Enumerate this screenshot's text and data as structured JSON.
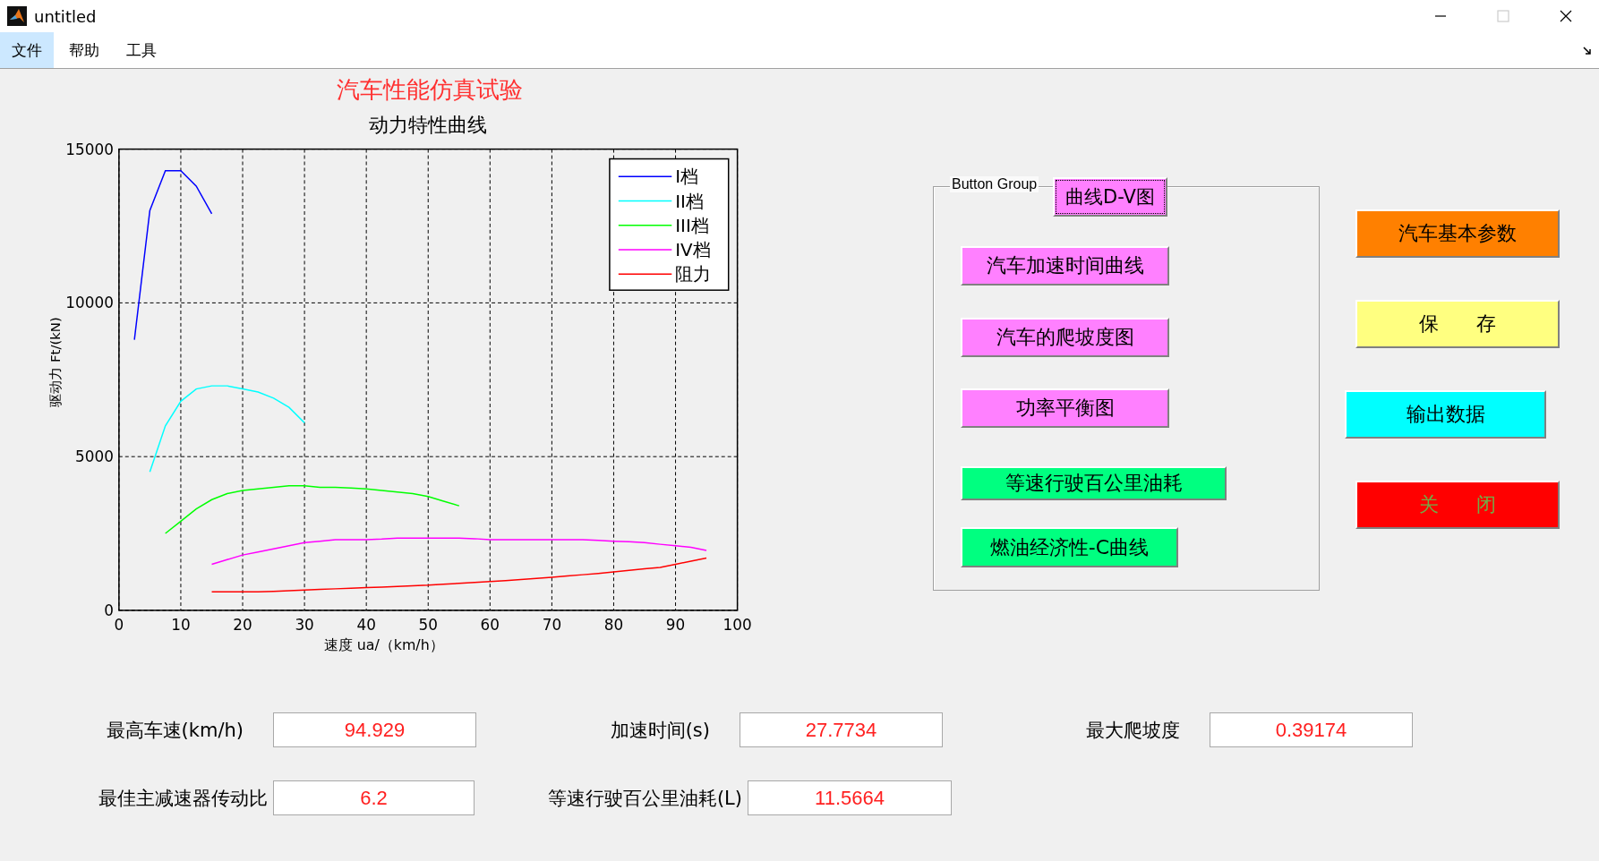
{
  "window": {
    "title": "untitled"
  },
  "menu": [
    {
      "label": "文件",
      "selected": true
    },
    {
      "label": "帮助",
      "selected": false
    },
    {
      "label": "工具",
      "selected": false
    }
  ],
  "heading": "汽车性能仿真试验",
  "chart": {
    "chart_data": {
      "type": "line",
      "title": "动力特性曲线",
      "xlabel": "速度 ua/（km/h）",
      "ylabel": "驱动力 Ft/(kN)",
      "x": [
        2.5,
        5,
        7.5,
        10,
        12.5,
        15,
        17.5,
        20,
        22.5,
        25,
        27.5,
        30,
        32.5,
        35,
        37.5,
        40,
        42.5,
        45,
        47.5,
        50,
        52.5,
        55,
        57.5,
        60,
        62.5,
        65,
        67.5,
        70,
        72.5,
        75,
        77.5,
        80,
        82.5,
        85,
        87.5,
        90,
        92.5,
        95
      ],
      "series": [
        {
          "name": "I档",
          "color": "#0000ff",
          "values": [
            8800,
            13000,
            14300,
            14300,
            13800,
            12900,
            null,
            null,
            null,
            null,
            null,
            null,
            null,
            null,
            null,
            null,
            null,
            null,
            null,
            null,
            null,
            null,
            null,
            null,
            null,
            null,
            null,
            null,
            null,
            null,
            null,
            null,
            null,
            null,
            null,
            null,
            null,
            null
          ]
        },
        {
          "name": "II档",
          "color": "#00ffff",
          "values": [
            null,
            4500,
            6000,
            6800,
            7200,
            7300,
            7300,
            7200,
            7100,
            6900,
            6600,
            6100,
            null,
            null,
            null,
            null,
            null,
            null,
            null,
            null,
            null,
            null,
            null,
            null,
            null,
            null,
            null,
            null,
            null,
            null,
            null,
            null,
            null,
            null,
            null,
            null,
            null,
            null
          ]
        },
        {
          "name": "III档",
          "color": "#00ff00",
          "values": [
            null,
            null,
            2500,
            2900,
            3300,
            3600,
            3800,
            3900,
            3950,
            4000,
            4050,
            4050,
            4000,
            4000,
            3980,
            3950,
            3900,
            3850,
            3800,
            3700,
            3550,
            3400,
            null,
            null,
            null,
            null,
            null,
            null,
            null,
            null,
            null,
            null,
            null,
            null,
            null,
            null,
            null,
            null
          ]
        },
        {
          "name": "IV档",
          "color": "#ff00ff",
          "values": [
            null,
            null,
            null,
            null,
            null,
            1500,
            1650,
            1800,
            1900,
            2000,
            2100,
            2200,
            2250,
            2300,
            2300,
            2300,
            2320,
            2350,
            2350,
            2350,
            2350,
            2350,
            2330,
            2300,
            2300,
            2300,
            2300,
            2300,
            2300,
            2300,
            2280,
            2250,
            2230,
            2200,
            2150,
            2100,
            2050,
            1950
          ]
        },
        {
          "name": "阻力",
          "color": "#ff0000",
          "values": [
            null,
            null,
            null,
            null,
            null,
            600,
            600,
            600,
            600,
            620,
            640,
            660,
            680,
            700,
            720,
            740,
            760,
            780,
            800,
            820,
            850,
            880,
            910,
            940,
            970,
            1000,
            1040,
            1080,
            1120,
            1160,
            1200,
            1250,
            1300,
            1350,
            1400,
            1500,
            1600,
            1700
          ]
        }
      ],
      "xlim": [
        0,
        100
      ],
      "ylim": [
        0,
        15000
      ],
      "xticks": [
        0,
        10,
        20,
        30,
        40,
        50,
        60,
        70,
        80,
        90,
        100
      ],
      "yticks": [
        0,
        5000,
        10000,
        15000
      ],
      "grid": true,
      "legend": true
    }
  },
  "button_group": {
    "title": "Button Group",
    "buttons": [
      {
        "label": "曲线D-V图",
        "color": "#ff80ff",
        "focused": true
      },
      {
        "label": "汽车加速时间曲线",
        "color": "#ff80ff",
        "focused": false
      },
      {
        "label": "汽车的爬坡度图",
        "color": "#ff80ff",
        "focused": false
      },
      {
        "label": "功率平衡图",
        "color": "#ff80ff",
        "focused": false
      },
      {
        "label": "等速行驶百公里油耗",
        "color": "#00ff80",
        "focused": false
      },
      {
        "label": "燃油经济性-C曲线",
        "color": "#00ff80",
        "focused": false
      }
    ]
  },
  "side_buttons": [
    {
      "label": "汽车基本参数",
      "color": "#ff8000"
    },
    {
      "label": "保      存",
      "color": "#ffff80"
    },
    {
      "label": "输出数据",
      "color": "#00ffff"
    },
    {
      "label": "关      闭",
      "color": "#ff0000"
    }
  ],
  "fields": [
    [
      {
        "label": "最高车速(km/h)",
        "value": "94.929"
      },
      {
        "label": "加速时间(s)",
        "value": "27.7734"
      },
      {
        "label": "最大爬坡度",
        "value": "0.39174"
      }
    ],
    [
      {
        "label": "最佳主减速器传动比",
        "value": "6.2"
      },
      {
        "label": "等速行驶百公里油耗(L)",
        "value": "11.5664"
      }
    ]
  ]
}
